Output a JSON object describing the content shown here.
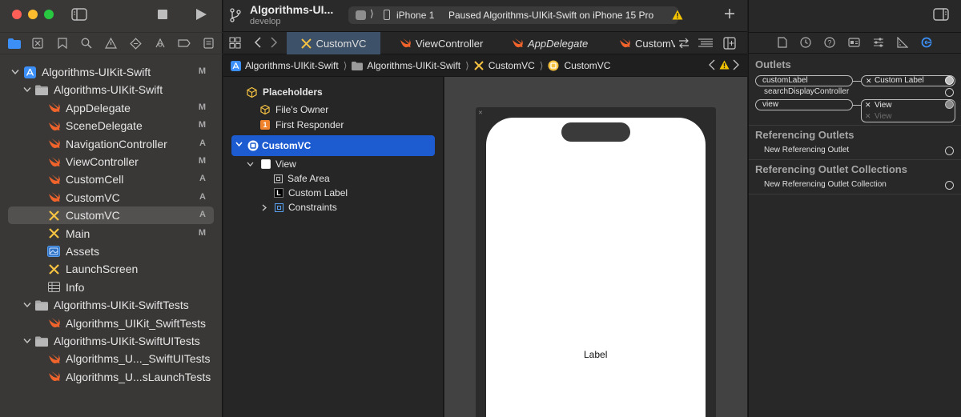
{
  "sidebar": {
    "badge_markers": {
      "modified": "M",
      "added": "A"
    },
    "items": [
      {
        "label": "Algorithms-UIKit-Swift",
        "badge": "M",
        "icon": "project-icon"
      },
      {
        "label": "Algorithms-UIKit-Swift",
        "badge": "",
        "icon": "folder-icon"
      },
      {
        "label": "AppDelegate",
        "badge": "M",
        "icon": "swift-file-icon"
      },
      {
        "label": "SceneDelegate",
        "badge": "M",
        "icon": "swift-file-icon"
      },
      {
        "label": "NavigationController",
        "badge": "A",
        "icon": "swift-file-icon"
      },
      {
        "label": "ViewController",
        "badge": "M",
        "icon": "swift-file-icon"
      },
      {
        "label": "CustomCell",
        "badge": "A",
        "icon": "swift-file-icon"
      },
      {
        "label": "CustomVC",
        "badge": "A",
        "icon": "swift-file-icon"
      },
      {
        "label": "CustomVC",
        "badge": "A",
        "icon": "xib-file-icon"
      },
      {
        "label": "Main",
        "badge": "M",
        "icon": "storyboard-file-icon"
      },
      {
        "label": "Assets",
        "badge": "",
        "icon": "asset-catalog-icon"
      },
      {
        "label": "LaunchScreen",
        "badge": "",
        "icon": "storyboard-file-icon"
      },
      {
        "label": "Info",
        "badge": "",
        "icon": "plist-icon"
      },
      {
        "label": "Algorithms-UIKit-SwiftTests",
        "badge": "",
        "icon": "folder-icon"
      },
      {
        "label": "Algorithms_UIKit_SwiftTests",
        "badge": "",
        "icon": "swift-file-icon"
      },
      {
        "label": "Algorithms-UIKit-SwiftUITests",
        "badge": "",
        "icon": "folder-icon"
      },
      {
        "label": "Algorithms_U..._SwiftUITests",
        "badge": "",
        "icon": "swift-file-icon"
      },
      {
        "label": "Algorithms_U...sLaunchTests",
        "badge": "",
        "icon": "swift-file-icon"
      }
    ]
  },
  "toolbar": {
    "project_name": "Algorithms-UI...",
    "branch": "develop",
    "destination_device": "iPhone 1",
    "status_text": "Paused Algorithms-UIKit-Swift on iPhone 15 Pro"
  },
  "tabs": [
    {
      "label": "CustomVC",
      "icon": "xib-file-icon",
      "active": true
    },
    {
      "label": "ViewController",
      "icon": "swift-file-icon",
      "active": false
    },
    {
      "label": "AppDelegate",
      "icon": "swift-file-icon",
      "active": false
    },
    {
      "label": "CustomV",
      "icon": "swift-file-icon",
      "active": false
    }
  ],
  "jumpbar": {
    "crumbs": [
      "Algorithms-UIKit-Swift",
      "Algorithms-UIKit-Swift",
      "CustomVC",
      "CustomVC"
    ]
  },
  "outline": {
    "placeholders_title": "Placeholders",
    "files_owner": "File's Owner",
    "first_responder": "First Responder",
    "first_responder_badge": "1",
    "root": "CustomVC",
    "view": "View",
    "safe_area": "Safe Area",
    "custom_label": "Custom Label",
    "label_badge": "L",
    "constraints": "Constraints"
  },
  "canvas": {
    "label_text": "Label"
  },
  "inspector": {
    "outlets_title": "Outlets",
    "outlets": [
      {
        "name": "customLabel",
        "target": "Custom Label"
      },
      {
        "name": "searchDisplayController",
        "target": ""
      },
      {
        "name": "view",
        "target": "View",
        "target_secondary": "View"
      }
    ],
    "referencing_outlets_title": "Referencing Outlets",
    "new_referencing_outlet": "New Referencing Outlet",
    "referencing_collections_title": "Referencing Outlet Collections",
    "new_referencing_collection": "New Referencing Outlet Collection"
  },
  "colors": {
    "selection_blue": "#1d5bd0",
    "swift_orange": "#f0642c",
    "xib_yellow": "#f5c242",
    "accent_blue": "#3b8ff6",
    "warning_yellow": "#f5c400"
  }
}
